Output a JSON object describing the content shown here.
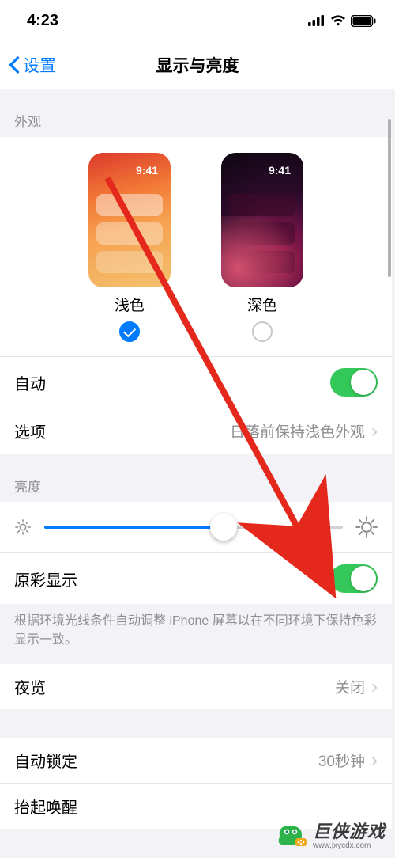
{
  "status": {
    "time": "4:23"
  },
  "nav": {
    "back_label": "设置",
    "title": "显示与亮度"
  },
  "appearance": {
    "header": "外观",
    "thumb_time": "9:41",
    "light_label": "浅色",
    "dark_label": "深色",
    "selected": "light"
  },
  "auto_row": {
    "label": "自动",
    "enabled": true
  },
  "option_row": {
    "label": "选项",
    "value": "日落前保持浅色外观"
  },
  "brightness": {
    "header": "亮度",
    "slider_percent": 60,
    "truetone_label": "原彩显示",
    "truetone_enabled": true,
    "footer": "根据环境光线条件自动调整 iPhone 屏幕以在不同环境下保持色彩显示一致。"
  },
  "night_shift": {
    "label": "夜览",
    "value": "关闭"
  },
  "auto_lock": {
    "label": "自动锁定",
    "value": "30秒钟"
  },
  "raise_to_wake": {
    "label": "抬起唤醒"
  },
  "watermark": {
    "brand": "巨侠游戏",
    "url": "www.jxycdx.com"
  }
}
